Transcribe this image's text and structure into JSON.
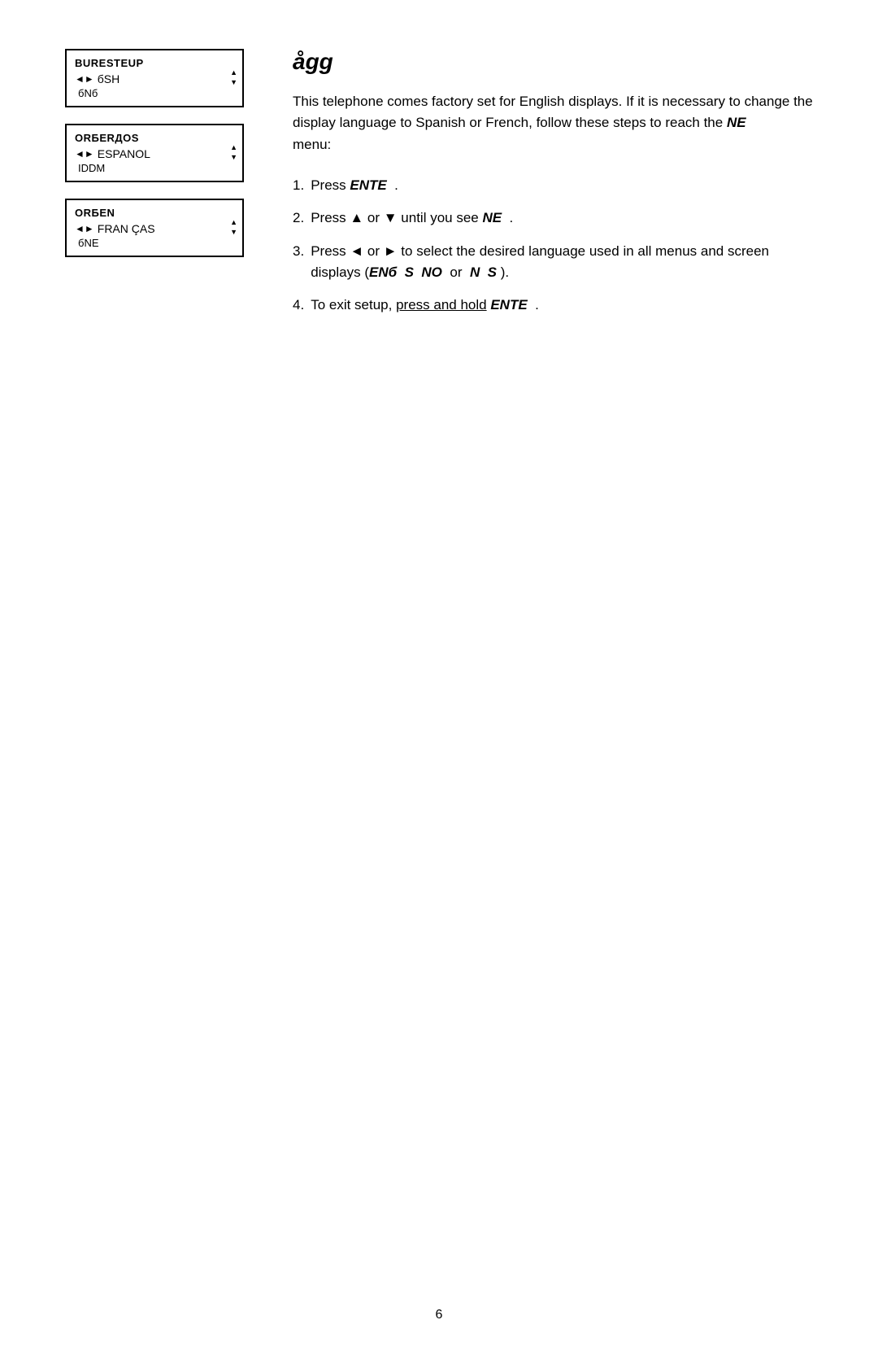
{
  "page": {
    "title": "ågg",
    "number": "6"
  },
  "intro": {
    "text": "This telephone comes factory set for English displays. If it is necessary to change the display language to Spanish or French, follow these steps to reach the",
    "menu_label": "NE",
    "menu_suffix": "menu:"
  },
  "steps": [
    {
      "num": "1.",
      "text_before": "Press",
      "bold_italic": "ENTE",
      "text_after": "."
    },
    {
      "num": "2.",
      "text_before": "Press ▲ or ▼ until you see",
      "bold_italic": "NE",
      "text_after": "."
    },
    {
      "num": "3.",
      "text_before": "Press ◄ or ► to select the desired language used in all menus and screen displays (",
      "option1_bi": "ENб",
      "option1_s": "S",
      "option2_no": "NO",
      "option2_or": "or",
      "option3_n": "N",
      "option3_s": "S",
      "text_close": ")."
    },
    {
      "num": "4.",
      "text_before": "To exit setup,",
      "underline": "press and hold",
      "bold_italic": "ENTE",
      "text_after": "."
    }
  ],
  "screen1": {
    "title": "BURESTEUP",
    "item_arrow": "◄►",
    "item_label": "бSH",
    "sub_label": "бNб"
  },
  "screen2": {
    "title": "ORБЕRДОS",
    "item_arrow": "◄►",
    "item_label": "ESPANOL",
    "sub_label": "IDDM"
  },
  "screen3": {
    "title": "ORБЕN",
    "item_arrow": "◄►",
    "item_label": "FRAN ÇAS",
    "sub_label": "бNE"
  }
}
